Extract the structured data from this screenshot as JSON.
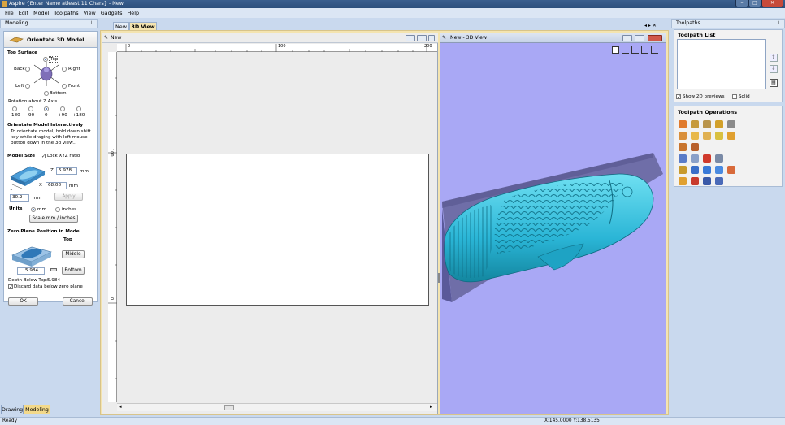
{
  "window": {
    "title": "Aspire {Enter Name atleast 11 Chars} - New"
  },
  "menu": [
    "File",
    "Edit",
    "Model",
    "Toolpaths",
    "View",
    "Gadgets",
    "Help"
  ],
  "left_panel": {
    "header": "Modeling",
    "title": "Orientate 3D Model",
    "top_surface": {
      "label": "Top Surface",
      "options": {
        "top": "Top",
        "back": "Back",
        "right": "Right",
        "left": "Left",
        "front": "Front",
        "bottom": "Bottom"
      },
      "selected": "Top"
    },
    "rotation": {
      "label": "Rotation about Z Axis",
      "options": [
        "-180",
        "-90",
        "0",
        "+90",
        "+180"
      ],
      "selected": "0"
    },
    "interactive": {
      "label": "Orientate Model Interactively",
      "text": [
        "To orientate model, hold down shift",
        "key while draging with left mouse",
        "button down in the  3d view.."
      ]
    },
    "model_size": {
      "label": "Model Size",
      "lock_label": "Lock XYZ ratio",
      "z_label": "Z",
      "z_value": "5.978",
      "z_unit": "mm",
      "x_label": "X",
      "x_value": "68.08",
      "x_unit": "mm",
      "y_label": "Y",
      "y_value": "30.2",
      "y_unit": "mm",
      "apply_label": "Apply"
    },
    "units": {
      "label": "Units",
      "mm": "mm",
      "inches": "inches",
      "selected": "mm",
      "scale_button": "Scale mm / inches"
    },
    "zero_plane": {
      "label": "Zero Plane Position in Model",
      "top": "Top",
      "middle": "Middle",
      "bottom": "Bottom",
      "value": "5.984",
      "depth_label": "Depth Below Top:",
      "depth_value": "5.984",
      "discard_label": "Discard data below zero plane"
    },
    "ok_label": "OK",
    "cancel_label": "Cancel",
    "tabs": [
      "Drawing",
      "Modeling"
    ]
  },
  "center": {
    "tabs": [
      "New",
      "3D View"
    ],
    "view2d_title": "New",
    "view3d_title": "New - 3D View",
    "ruler_top": [
      "0",
      "100",
      "200"
    ],
    "ruler_left": [
      "0",
      "100"
    ]
  },
  "right_panel": {
    "header": "Toolpaths",
    "list_label": "Toolpath List",
    "show_2d": "Show 2D previews",
    "solid": "Solid",
    "ops_label": "Toolpath Operations"
  },
  "status": {
    "left": "Ready",
    "coords": "X:145.0000 Y:138.5135"
  },
  "colors": {
    "accent": "#2c4f7c",
    "background_3d": "#a9a8f5",
    "model": "#2fb8d6",
    "sheet": "#ffffff"
  }
}
